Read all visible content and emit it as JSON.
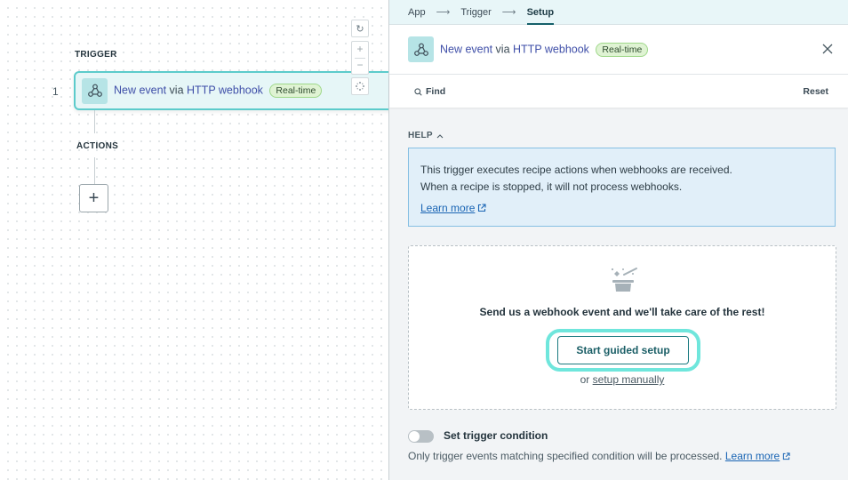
{
  "canvas": {
    "trigger_label": "TRIGGER",
    "actions_label": "ACTIONS",
    "step_number": "1",
    "trigger_card": {
      "event": "New event",
      "via": "via",
      "app": "HTTP webhook",
      "badge": "Real-time",
      "icon": "webhook-icon"
    },
    "add_step_label": "+",
    "zoom_controls": {
      "reset": "↻",
      "zoom_in": "+",
      "zoom_out": "−",
      "fit": "⤢"
    }
  },
  "panel": {
    "breadcrumb": [
      {
        "label": "App"
      },
      {
        "label": "Trigger"
      },
      {
        "label": "Setup",
        "active": true
      }
    ],
    "breadcrumb_arrow": "⟶",
    "header": {
      "event": "New event",
      "via": "via",
      "app": "HTTP webhook",
      "badge": "Real-time",
      "close": "✕"
    },
    "find_label": "Find",
    "reset_label": "Reset",
    "help": {
      "label": "HELP",
      "line1": "This trigger executes recipe actions when webhooks are received.",
      "line2": "When a recipe is stopped, it will not process webhooks.",
      "link": "Learn more"
    },
    "guided": {
      "message": "Send us a webhook event and we'll take care of the rest!",
      "button": "Start guided setup",
      "or": "or",
      "manual_link": "setup manually"
    },
    "condition": {
      "label": "Set trigger condition",
      "enabled": false,
      "description": "Only trigger events matching specified condition will be processed.",
      "link": "Learn more"
    }
  },
  "colors": {
    "accent_teal": "#5ccbcb",
    "link_blue": "#1964b4",
    "app_name_blue": "#3f4fa8",
    "badge_green": "#dff3d3"
  }
}
